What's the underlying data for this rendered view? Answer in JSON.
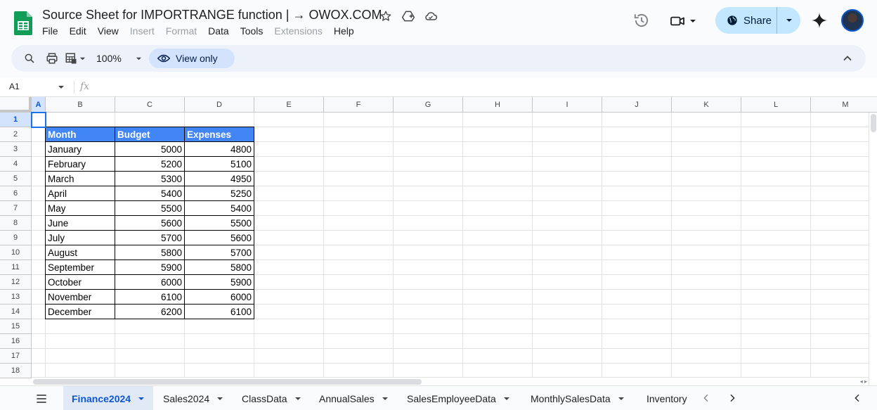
{
  "app": {
    "title": "Source Sheet for IMPORTRANGE function | → OWOX.COM",
    "menu": [
      {
        "label": "File",
        "disabled": false
      },
      {
        "label": "Edit",
        "disabled": false
      },
      {
        "label": "View",
        "disabled": false
      },
      {
        "label": "Insert",
        "disabled": true
      },
      {
        "label": "Format",
        "disabled": true
      },
      {
        "label": "Data",
        "disabled": false
      },
      {
        "label": "Tools",
        "disabled": false
      },
      {
        "label": "Extensions",
        "disabled": true
      },
      {
        "label": "Help",
        "disabled": false
      }
    ],
    "share_label": "Share"
  },
  "toolbar": {
    "zoom": "100%",
    "view_only_label": "View only"
  },
  "formula": {
    "cell_ref": "A1",
    "fx": "fx"
  },
  "grid": {
    "columns": [
      "A",
      "B",
      "C",
      "D",
      "E",
      "F",
      "G",
      "H",
      "I",
      "J",
      "K",
      "L",
      "M"
    ],
    "rows": [
      "1",
      "2",
      "3",
      "4",
      "5",
      "6",
      "7",
      "8",
      "9",
      "10",
      "11",
      "12",
      "13",
      "14",
      "15",
      "16",
      "17",
      "18"
    ],
    "table_header": [
      "Month",
      "Budget",
      "Expenses"
    ],
    "table_rows": [
      [
        "January",
        "5000",
        "4800"
      ],
      [
        "February",
        "5200",
        "5100"
      ],
      [
        "March",
        "5300",
        "4950"
      ],
      [
        "April",
        "5400",
        "5250"
      ],
      [
        "May",
        "5500",
        "5400"
      ],
      [
        "June",
        "5600",
        "5500"
      ],
      [
        "July",
        "5700",
        "5600"
      ],
      [
        "August",
        "5800",
        "5700"
      ],
      [
        "September",
        "5900",
        "5800"
      ],
      [
        "October",
        "6000",
        "5900"
      ],
      [
        "November",
        "6100",
        "6000"
      ],
      [
        "December",
        "6200",
        "6100"
      ]
    ],
    "header_color": "#4285f4"
  },
  "sheets": [
    {
      "label": "Finance2024",
      "active": true
    },
    {
      "label": "Sales2024",
      "active": false
    },
    {
      "label": "ClassData",
      "active": false
    },
    {
      "label": "AnnualSales",
      "active": false
    },
    {
      "label": "SalesEmployeeData",
      "active": false
    },
    {
      "label": "MonthlySalesData",
      "active": false
    },
    {
      "label": "Inventory",
      "active": false
    }
  ]
}
